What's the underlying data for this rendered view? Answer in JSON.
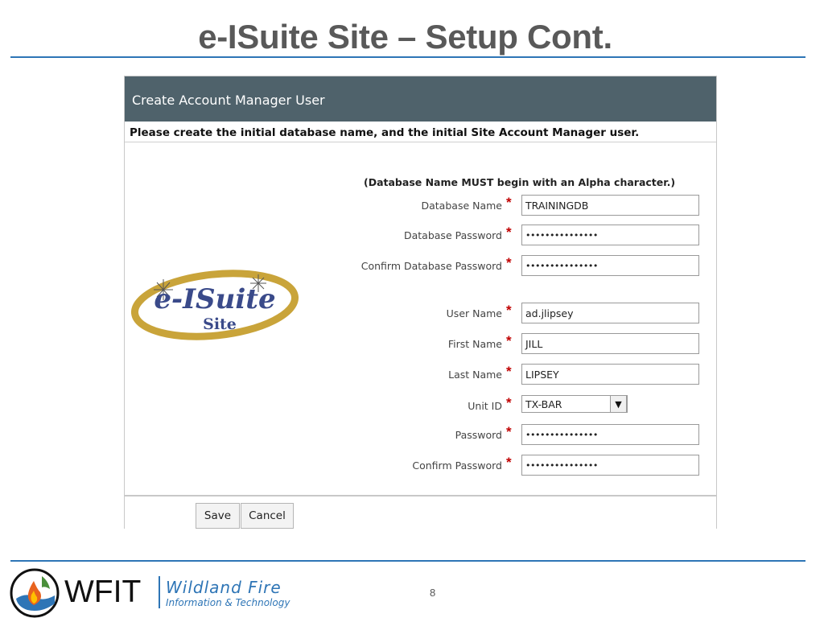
{
  "slide": {
    "title": "e-ISuite Site – Setup Cont.",
    "page_number": "8"
  },
  "dialog": {
    "title": "Create Account Manager User",
    "instructions": "Please create the initial database name, and the initial Site Account Manager user.",
    "hint": "(Database Name MUST begin with an Alpha character.)",
    "required_marker": "*",
    "logo": {
      "main": "e-ISuite",
      "sub": "Site"
    },
    "fields": {
      "database_name": {
        "label": "Database Name",
        "value": "TRAININGDB"
      },
      "database_password": {
        "label": "Database Password",
        "value": "•••••••••••••••"
      },
      "confirm_database_password": {
        "label": "Confirm Database Password",
        "value": "•••••••••••••••"
      },
      "user_name": {
        "label": "User Name",
        "value": "ad.jlipsey"
      },
      "first_name": {
        "label": "First Name",
        "value": "JILL"
      },
      "last_name": {
        "label": "Last Name",
        "value": "LIPSEY"
      },
      "unit_id": {
        "label": "Unit ID",
        "value": "TX-BAR",
        "dropdown_glyph": "▼"
      },
      "password": {
        "label": "Password",
        "value": "•••••••••••••••"
      },
      "confirm_password": {
        "label": "Confirm Password",
        "value": "•••••••••••••••"
      }
    },
    "buttons": {
      "save": "Save",
      "cancel": "Cancel"
    }
  },
  "footer": {
    "brand": "WFIT",
    "brand_line1": "Wildland Fire",
    "brand_line2": "Information & Technology"
  },
  "colors": {
    "accent_blue": "#2e75b6",
    "dialog_header": "#4f626b",
    "required_red": "#c00000",
    "title_gray": "#595959"
  }
}
